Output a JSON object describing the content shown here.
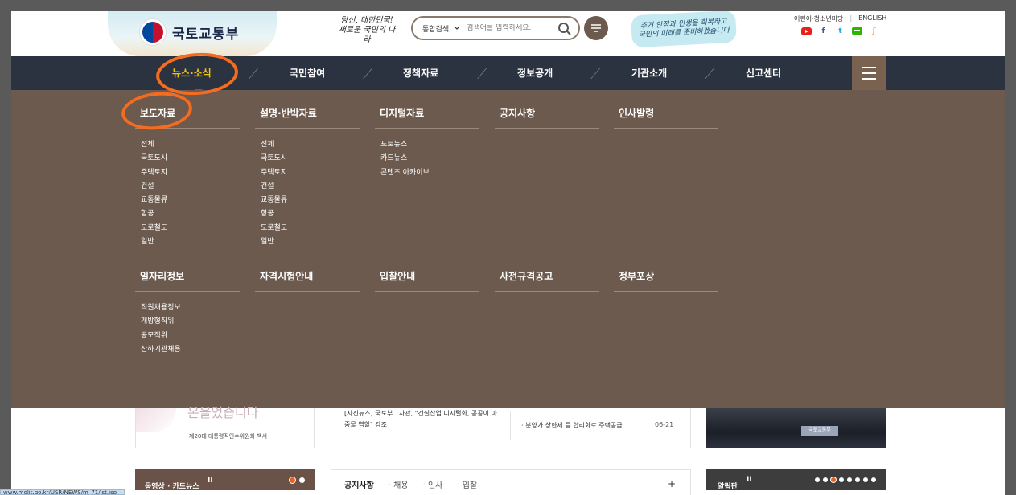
{
  "logo": {
    "text": "국토교통부"
  },
  "slogan": {
    "line1": "당신, 대한민국!",
    "line2": "새로운 국민의 나라"
  },
  "search": {
    "scope": "통합검색",
    "placeholder": "검색어를 입력하세요."
  },
  "promo": {
    "line1": "주거 안정과 민생을 회복하고",
    "line2": "국민의 미래를 준비하겠습니다"
  },
  "util": {
    "kids": "어린이·청소년마당",
    "english": "ENGLISH"
  },
  "sns": [
    "youtube-icon",
    "facebook-icon",
    "twitter-icon",
    "blog-icon",
    "kakaostory-icon"
  ],
  "nav": {
    "items": [
      {
        "label": "뉴스·소식",
        "active": true
      },
      {
        "label": "국민참여"
      },
      {
        "label": "정책자료"
      },
      {
        "label": "정보공개"
      },
      {
        "label": "기관소개"
      },
      {
        "label": "신고센터"
      }
    ]
  },
  "mega_menu": {
    "row1": [
      {
        "title": "보도자료",
        "links": [
          "전체",
          "국토도시",
          "주택토지",
          "건설",
          "교통물류",
          "항공",
          "도로철도",
          "일반"
        ]
      },
      {
        "title": "설명·반박자료",
        "links": [
          "전체",
          "국토도시",
          "주택토지",
          "건설",
          "교통물류",
          "항공",
          "도로철도",
          "일반"
        ]
      },
      {
        "title": "디지털자료",
        "links": [
          "포토뉴스",
          "카드뉴스",
          "콘텐츠 아카이브"
        ]
      },
      {
        "title": "공지사항",
        "links": []
      },
      {
        "title": "인사발령",
        "links": []
      }
    ],
    "row2": [
      {
        "title": "일자리정보",
        "links": [
          "직원채용정보",
          "개방형직위",
          "공모직위",
          "산하기관채용"
        ]
      },
      {
        "title": "자격시험안내",
        "links": []
      },
      {
        "title": "입찰안내",
        "links": []
      },
      {
        "title": "사전규격공고",
        "links": []
      },
      {
        "title": "정부포상",
        "links": []
      }
    ]
  },
  "below": {
    "card1_big": "온을었습니다",
    "card1_small": "제20대 대통령직인수위원회 백서",
    "card2_text": "[사진뉴스] 국토부 1차관, \"건설산업 디지털화, 공공이 마중물 역할\" 강조",
    "card2_item": "분양가 상한제 등 합리화로 주택공급 …",
    "card2_date": "06-21",
    "photo_sign": "국토교통부",
    "video_title": "동영상 · 카드뉴스",
    "tabs": [
      "공지사항",
      "채용",
      "인사",
      "입찰"
    ],
    "notice_title": "알림판"
  },
  "statusbar": {
    "url": "www.molit.go.kr/USR/NEWS/m_71/lst.jsp"
  },
  "colors": {
    "nav_bg": "#2b3240",
    "mega_bg": "#6b5a4d",
    "active": "#f5c400",
    "annotation": "#f36c21"
  }
}
